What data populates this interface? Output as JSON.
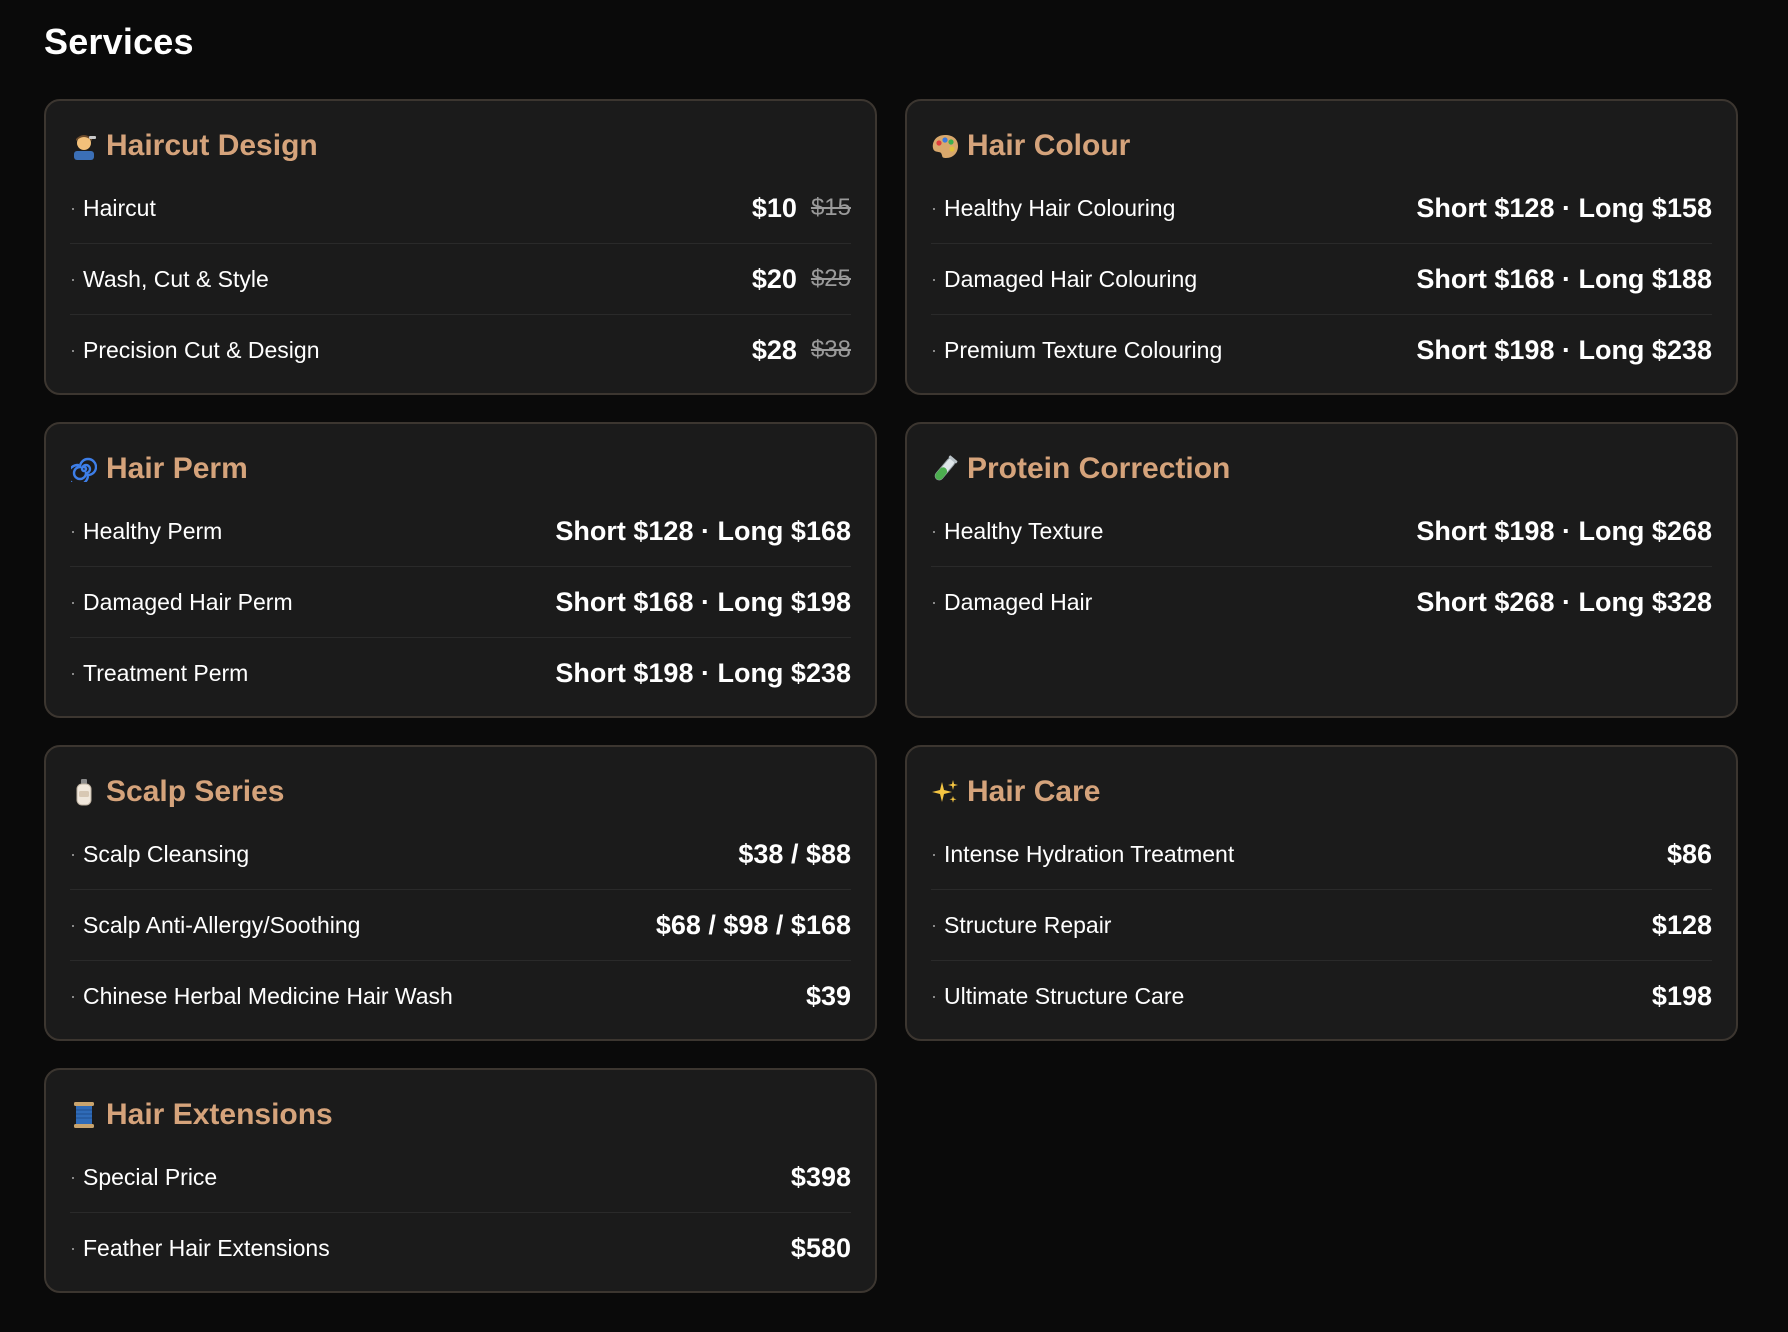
{
  "page": {
    "title": "Services"
  },
  "accent_color": "#d5a37b",
  "cards": [
    {
      "icon": "barber-icon",
      "title": "Haircut Design",
      "rows": [
        {
          "label": "Haircut",
          "price": "$10",
          "old_price": "$15"
        },
        {
          "label": "Wash, Cut & Style",
          "price": "$20",
          "old_price": "$25"
        },
        {
          "label": "Precision Cut & Design",
          "price": "$28",
          "old_price": "$38"
        }
      ]
    },
    {
      "icon": "palette-icon",
      "title": "Hair Colour",
      "rows": [
        {
          "label": "Healthy Hair Colouring",
          "price": "Short $128 · Long $158"
        },
        {
          "label": "Damaged Hair Colouring",
          "price": "Short $168 · Long $188"
        },
        {
          "label": "Premium Texture Colouring",
          "price": "Short $198 · Long $238"
        }
      ]
    },
    {
      "icon": "spiral-icon",
      "title": "Hair Perm",
      "rows": [
        {
          "label": "Healthy Perm",
          "price": "Short $128 · Long $168"
        },
        {
          "label": "Damaged Hair Perm",
          "price": "Short $168 · Long $198"
        },
        {
          "label": "Treatment Perm",
          "price": "Short $198 · Long $238"
        }
      ]
    },
    {
      "icon": "test-tube-icon",
      "title": "Protein Correction",
      "rows": [
        {
          "label": "Healthy Texture",
          "price": "Short $198 · Long $268"
        },
        {
          "label": "Damaged Hair",
          "price": "Short $268 · Long $328"
        }
      ]
    },
    {
      "icon": "lotion-bottle-icon",
      "title": "Scalp Series",
      "rows": [
        {
          "label": "Scalp Cleansing",
          "price": "$38 / $88"
        },
        {
          "label": "Scalp Anti-Allergy/Soothing",
          "price": "$68 / $98 / $168"
        },
        {
          "label": "Chinese Herbal Medicine Hair Wash",
          "price": "$39"
        }
      ]
    },
    {
      "icon": "sparkles-icon",
      "title": "Hair Care",
      "rows": [
        {
          "label": "Intense Hydration Treatment",
          "price": "$86"
        },
        {
          "label": "Structure Repair",
          "price": "$128"
        },
        {
          "label": "Ultimate Structure Care",
          "price": "$198"
        }
      ]
    },
    {
      "icon": "thread-spool-icon",
      "title": "Hair Extensions",
      "rows": [
        {
          "label": "Special Price",
          "price": "$398"
        },
        {
          "label": "Feather Hair Extensions",
          "price": "$580"
        }
      ]
    }
  ]
}
